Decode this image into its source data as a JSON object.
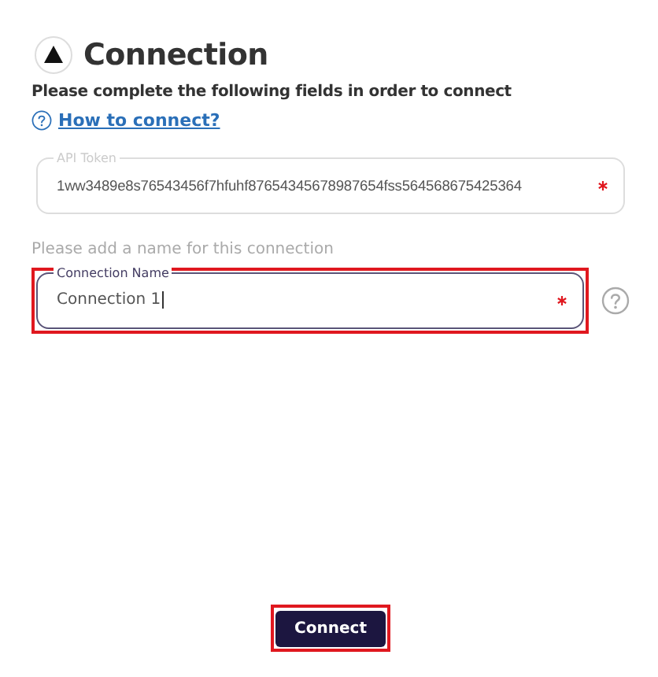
{
  "header": {
    "title": "Connection"
  },
  "instructions": "Please complete the following fields in order to connect",
  "help_link": "How to connect?",
  "api_token": {
    "label": "API Token",
    "value": "1ww3489e8s76543456f7hfuhf87654345678987654fss564568675425364",
    "required": true,
    "disabled": true,
    "highlighted": false
  },
  "name_hint": "Please add a name for this connection",
  "connection_name": {
    "label": "Connection Name",
    "value": "Connection 1",
    "required": true,
    "disabled": false,
    "highlighted": true
  },
  "connect_button": {
    "label": "Connect",
    "highlighted": true
  }
}
